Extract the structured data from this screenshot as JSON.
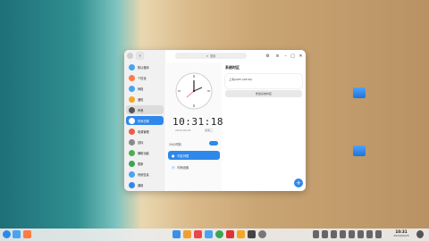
{
  "window": {
    "search_placeholder": "搜索",
    "sidebar_items": [
      {
        "label": "默认程序",
        "color": "#4aa3f0"
      },
      {
        "label": "个性化",
        "color": "#ff7a45"
      },
      {
        "label": "网络",
        "color": "#4aa3f0"
      },
      {
        "label": "通知",
        "color": "#f5a623"
      },
      {
        "label": "声音",
        "color": "#555555"
      },
      {
        "label": "时间日期",
        "color": "#2e88ea"
      },
      {
        "label": "电源管理",
        "color": "#f05a4a"
      },
      {
        "label": "鼠标",
        "color": "#8a8a8a"
      },
      {
        "label": "辅助功能",
        "color": "#4caf50"
      },
      {
        "label": "更新",
        "color": "#3aa655"
      },
      {
        "label": "系统信息",
        "color": "#4aa3f0"
      },
      {
        "label": "通用",
        "color": "#2e88ea"
      }
    ],
    "clock": {
      "time": "10:31:18",
      "date": "2024-09-25",
      "weekday": "星期三",
      "format_label": "24小时制"
    },
    "clock_menu": {
      "world_clock": "时区列表",
      "time_settings": "时间设置"
    },
    "timezone": {
      "title": "系统时区",
      "item": "上海(GMT+08:00)",
      "button": "修改系统时区"
    }
  },
  "taskbar": {
    "time": "10:31",
    "date": "2024/09/25"
  }
}
